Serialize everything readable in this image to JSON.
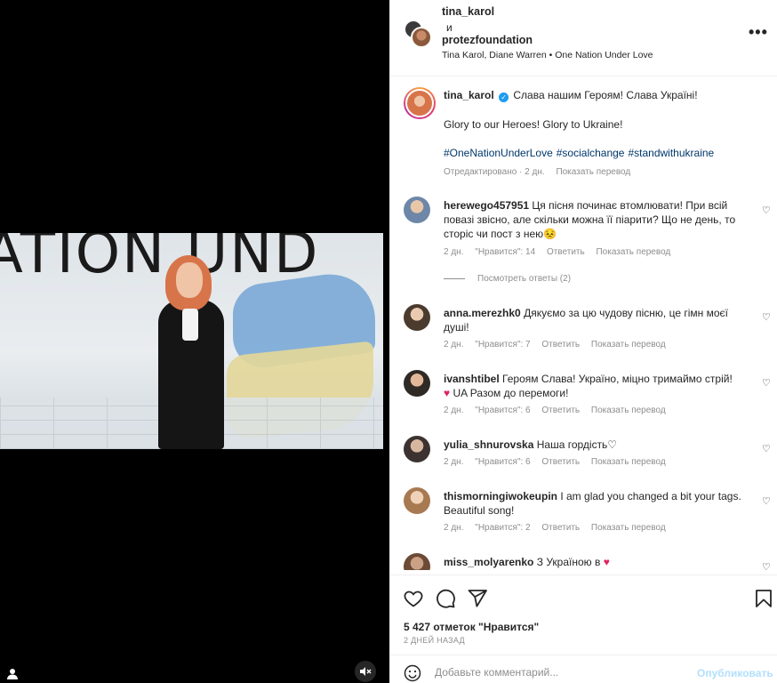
{
  "post": {
    "owner": "tina_karol",
    "conjunction": "и",
    "coowner": "protezfoundation",
    "audio": "Tina Karol, Diane Warren • One Nation Under Love",
    "video_text": "ATION UND"
  },
  "caption": {
    "username": "tina_karol",
    "text": "Слава нашим Героям! Слава Україні!",
    "text2": "Glory to our Heroes! Glory to Ukraine!",
    "hashtags": [
      "#OneNationUnderLove",
      "#socialchange",
      "#standwithukraine"
    ],
    "edited": "Отредактировано · 2 дн.",
    "translate": "Показать перевод"
  },
  "comments": [
    {
      "username": "herewego457951",
      "text": "Ця пісня починає втомлювати! При всій повазі звісно, але скільки можна її піарити? Що не день, то сторіс чи пост з нею😣",
      "age": "2 дн.",
      "likes": "\"Нравится\": 14",
      "reply": "Ответить",
      "translate": "Показать перевод",
      "replies": "Посмотреть ответы (2)"
    },
    {
      "username": "anna.merezhk0",
      "text": "Дякуємо за цю чудову пісню, це гімн моєї душі!",
      "age": "2 дн.",
      "likes": "\"Нравится\": 7",
      "reply": "Ответить",
      "translate": "Показать перевод"
    },
    {
      "username": "ivanshtibel",
      "text": "Героям Слава! Україно, міцно тримаймо стрій!",
      "text2": "UA Разом до перемоги!",
      "age": "2 дн.",
      "likes": "\"Нравится\": 6",
      "reply": "Ответить",
      "translate": "Показать перевод"
    },
    {
      "username": "yulia_shnurovska",
      "text": "Наша гордість♡",
      "age": "2 дн.",
      "likes": "\"Нравится\": 6",
      "reply": "Ответить",
      "translate": "Показать перевод"
    },
    {
      "username": "thismorningiwokeupin",
      "text": "I am glad you changed a bit your tags. Beautiful song!",
      "age": "2 дн.",
      "likes": "\"Нравится\": 2",
      "reply": "Ответить",
      "translate": "Показать перевод"
    },
    {
      "username": "miss_molyarenko",
      "text": "З Україною в"
    }
  ],
  "actions": {
    "likes": "5 427 отметок \"Нравится\"",
    "ago": "2 ДНЕЙ НАЗАД"
  },
  "composer": {
    "placeholder": "Добавьте комментарий...",
    "post_label": "Опубликовать"
  },
  "colors": {
    "link": "#00376b",
    "secondary_text": "#8e8e8e",
    "verified": "#1d9bf0",
    "heart_red": "#e0245e",
    "post_button_disabled": "#b2dffc"
  }
}
